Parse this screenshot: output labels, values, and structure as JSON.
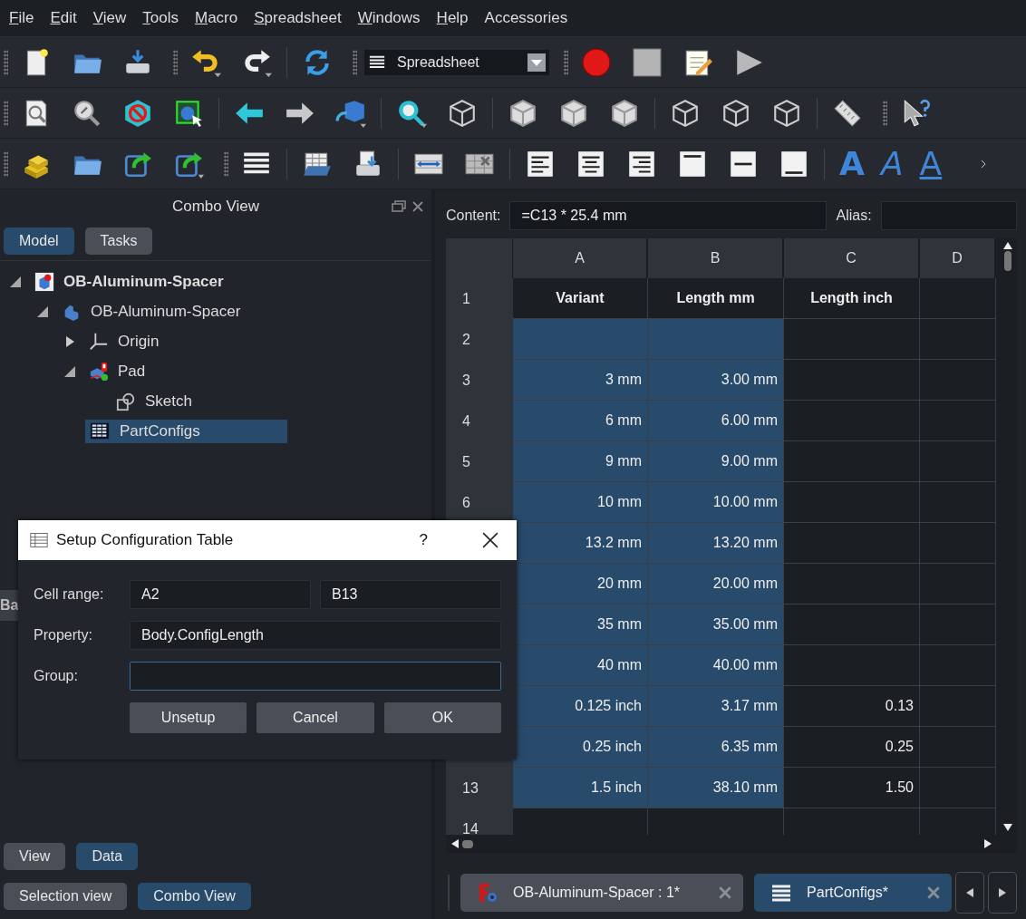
{
  "menu": [
    {
      "label": "File",
      "mnemonic": true
    },
    {
      "label": "Edit",
      "mnemonic": true
    },
    {
      "label": "View",
      "mnemonic": true
    },
    {
      "label": "Tools",
      "mnemonic": true
    },
    {
      "label": "Macro",
      "mnemonic": true
    },
    {
      "label": "Spreadsheet",
      "mnemonic": true
    },
    {
      "label": "Windows",
      "mnemonic": true
    },
    {
      "label": "Help",
      "mnemonic": true
    },
    {
      "label": "Accessories",
      "mnemonic": false
    }
  ],
  "toolbar": {
    "workbench": "Spreadsheet",
    "text_styles": [
      {
        "label": "A",
        "kind": "bold"
      },
      {
        "label": "A",
        "kind": "italic"
      },
      {
        "label": "A",
        "kind": "underline"
      }
    ]
  },
  "combo_view": {
    "title": "Combo View",
    "tabs": [
      {
        "label": "Model",
        "selected": true
      },
      {
        "label": "Tasks",
        "selected": false
      }
    ],
    "tree": [
      {
        "label": "OB-Aluminum-Spacer",
        "kind": "document",
        "expanded": true,
        "selected": false,
        "children": [
          {
            "label": "OB-Aluminum-Spacer",
            "kind": "body",
            "expanded": true,
            "selected": false,
            "children": [
              {
                "label": "Origin",
                "kind": "origin",
                "expanded": false,
                "selected": false
              },
              {
                "label": "Pad",
                "kind": "pad",
                "expanded": true,
                "selected": false,
                "children": [
                  {
                    "label": "Sketch",
                    "kind": "sketch",
                    "selected": false
                  }
                ]
              },
              {
                "label": "PartConfigs",
                "kind": "spreadsheet",
                "selected": true
              }
            ]
          }
        ]
      }
    ],
    "hidden_tab": "Ba",
    "property_tabs": [
      {
        "label": "View",
        "selected": false
      },
      {
        "label": "Data",
        "selected": true
      }
    ],
    "panel_tabs": [
      {
        "label": "Selection view",
        "selected": false
      },
      {
        "label": "Combo View",
        "selected": true
      }
    ]
  },
  "spreadsheet": {
    "content_label": "Content:",
    "content": "=C13 * 25.4 mm",
    "alias_label": "Alias:",
    "columns": [
      "A",
      "B",
      "C",
      "D"
    ],
    "rows": [
      {
        "label": "1",
        "kind": "heading",
        "cells": [
          {
            "text": "Variant",
            "selected": false
          },
          {
            "text": "Length mm",
            "selected": false
          },
          {
            "text": "Length inch",
            "selected": false
          },
          {
            "selected": false
          }
        ]
      },
      {
        "label": "2",
        "kind": "data",
        "cells": [
          {
            "selected": true
          },
          {
            "selected": true
          },
          {
            "selected": false
          },
          {
            "selected": false
          }
        ]
      },
      {
        "label": "3",
        "kind": "data",
        "cells": [
          {
            "text": "3 mm",
            "selected": true
          },
          {
            "text": "3.00 mm",
            "selected": true
          },
          {
            "selected": false
          },
          {
            "selected": false
          }
        ]
      },
      {
        "label": "4",
        "kind": "data",
        "cells": [
          {
            "text": "6 mm",
            "selected": true
          },
          {
            "text": "6.00 mm",
            "selected": true
          },
          {
            "selected": false
          },
          {
            "selected": false
          }
        ]
      },
      {
        "label": "5",
        "kind": "data",
        "cells": [
          {
            "text": "9 mm",
            "selected": true
          },
          {
            "text": "9.00 mm",
            "selected": true
          },
          {
            "selected": false
          },
          {
            "selected": false
          }
        ]
      },
      {
        "label": "6",
        "kind": "data",
        "cells": [
          {
            "text": "10 mm",
            "selected": true
          },
          {
            "text": "10.00 mm",
            "selected": true
          },
          {
            "selected": false
          },
          {
            "selected": false
          }
        ]
      },
      {
        "kind": "data",
        "cells": [
          {
            "text": "13.2 mm",
            "selected": true
          },
          {
            "text": "13.20 mm",
            "selected": true
          },
          {
            "selected": false
          },
          {
            "selected": false
          }
        ]
      },
      {
        "kind": "data",
        "cells": [
          {
            "text": "20 mm",
            "selected": true
          },
          {
            "text": "20.00 mm",
            "selected": true
          },
          {
            "selected": false
          },
          {
            "selected": false
          }
        ]
      },
      {
        "kind": "data",
        "cells": [
          {
            "text": "35 mm",
            "selected": true
          },
          {
            "text": "35.00 mm",
            "selected": true
          },
          {
            "selected": false
          },
          {
            "selected": false
          }
        ]
      },
      {
        "kind": "data",
        "cells": [
          {
            "text": "40 mm",
            "selected": true
          },
          {
            "text": "40.00 mm",
            "selected": true
          },
          {
            "selected": false
          },
          {
            "selected": false
          }
        ]
      },
      {
        "kind": "data",
        "cells": [
          {
            "text": "0.125 inch",
            "selected": true
          },
          {
            "text": "3.17 mm",
            "selected": true
          },
          {
            "text": "0.13",
            "selected": false
          },
          {
            "selected": false
          }
        ]
      },
      {
        "kind": "data",
        "cells": [
          {
            "text": "0.25 inch",
            "selected": true
          },
          {
            "text": "6.35 mm",
            "selected": true
          },
          {
            "text": "0.25",
            "selected": false
          },
          {
            "selected": false
          }
        ]
      },
      {
        "label": "13",
        "kind": "data",
        "cells": [
          {
            "text": "1.5 inch",
            "selected": true
          },
          {
            "text": "38.10 mm",
            "selected": true
          },
          {
            "text": "1.50",
            "selected": false
          },
          {
            "selected": false
          }
        ]
      },
      {
        "label": "14",
        "kind": "data",
        "cells": [
          {
            "selected": false
          },
          {
            "selected": false
          },
          {
            "selected": false
          },
          {
            "selected": false
          }
        ]
      }
    ]
  },
  "dialog": {
    "title": "Setup Configuration Table",
    "help": "?",
    "cell_range_label": "Cell range:",
    "range_from": "A2",
    "range_to": "B13",
    "property_label": "Property:",
    "property": "Body.ConfigLength",
    "group_label": "Group:",
    "group_focused": true,
    "buttons": [
      "Unsetup",
      "Cancel",
      "OK"
    ]
  },
  "document_tabs": [
    {
      "label": "OB-Aluminum-Spacer : 1*",
      "kind": "document",
      "selected": false
    },
    {
      "label": "PartConfigs*",
      "kind": "spreadsheet",
      "selected": true
    }
  ]
}
